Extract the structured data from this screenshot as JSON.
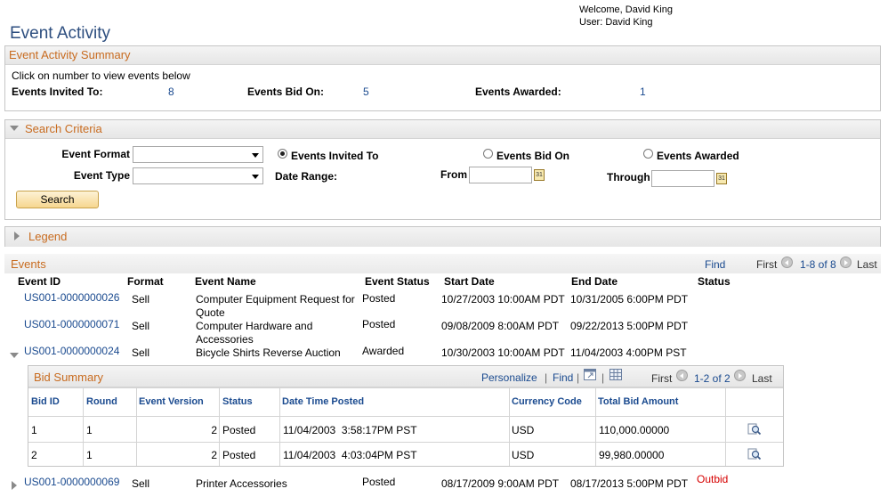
{
  "header": {
    "welcome": "Welcome, David King",
    "user": "User: David King",
    "title": "Event Activity"
  },
  "summary": {
    "title": "Event Activity Summary",
    "instruction": "Click on number to view events below",
    "invited_label": "Events Invited To:",
    "invited_count": "8",
    "bid_label": "Events Bid On:",
    "bid_count": "5",
    "awarded_label": "Events Awarded:",
    "awarded_count": "1"
  },
  "search": {
    "title": "Search Criteria",
    "event_format_label": "Event Format",
    "event_format_value": "",
    "event_type_label": "Event Type",
    "event_type_value": "",
    "radio_invited": "Events Invited To",
    "radio_bid": "Events Bid On",
    "radio_awarded": "Events Awarded",
    "date_range_label": "Date Range:",
    "from_label": "From",
    "from_value": "",
    "through_label": "Through",
    "through_value": "",
    "search_button": "Search",
    "calendar_icon_text": "31"
  },
  "legend": {
    "title": "Legend"
  },
  "events": {
    "title": "Events",
    "find": "Find",
    "first": "First",
    "range": "1-8 of 8",
    "last": "Last",
    "columns": [
      "Event ID",
      "Format",
      "Event Name",
      "Event Status",
      "Start Date",
      "End Date",
      "Status"
    ],
    "rows": [
      {
        "id": "US001-0000000026",
        "format": "Sell",
        "name_line1": "Computer Equipment Request for",
        "name_line2": "Quote",
        "event_status": "Posted",
        "start": "10/27/2003 10:00AM PDT",
        "end": "10/31/2005  6:00PM PDT",
        "status": ""
      },
      {
        "id": "US001-0000000071",
        "format": "Sell",
        "name_line1": "Computer Hardware and",
        "name_line2": "Accessories",
        "event_status": "Posted",
        "start": "09/08/2009  8:00AM PDT",
        "end": "09/22/2013  5:00PM PDT",
        "status": ""
      },
      {
        "id": "US001-0000000024",
        "format": "Sell",
        "name_line1": "Bicycle Shirts Reverse Auction",
        "name_line2": "",
        "event_status": "Awarded",
        "start": "10/30/2003 10:00AM PDT",
        "end": "11/04/2003  4:00PM PST",
        "status": ""
      },
      {
        "id": "US001-0000000069",
        "format": "Sell",
        "name_line1": "Printer Accessories",
        "name_line2": "",
        "event_status": "Posted",
        "start": "08/17/2009  9:00AM PDT",
        "end": "08/17/2013  5:00PM PDT",
        "status": "Outbid"
      }
    ]
  },
  "bid_summary": {
    "title": "Bid Summary",
    "personalize": "Personalize",
    "find": "Find",
    "first": "First",
    "range": "1-2 of 2",
    "last": "Last",
    "columns": [
      "Bid ID",
      "Round",
      "Event Version",
      "Status",
      "Date Time Posted",
      "Currency Code",
      "Total Bid Amount"
    ],
    "rows": [
      {
        "bid_id": "1",
        "round": "1",
        "version": "2",
        "status": "Posted",
        "posted": "11/04/2003  3:58:17PM PST",
        "currency": "USD",
        "amount": "110,000.00000"
      },
      {
        "bid_id": "2",
        "round": "1",
        "version": "2",
        "status": "Posted",
        "posted": "11/04/2003  4:03:04PM PST",
        "currency": "USD",
        "amount": "99,980.00000"
      }
    ]
  },
  "icons": {
    "collapse": "triangle-down-icon",
    "expand": "triangle-right-icon",
    "calendar": "calendar-icon",
    "view_bid": "magnify-document-icon"
  }
}
